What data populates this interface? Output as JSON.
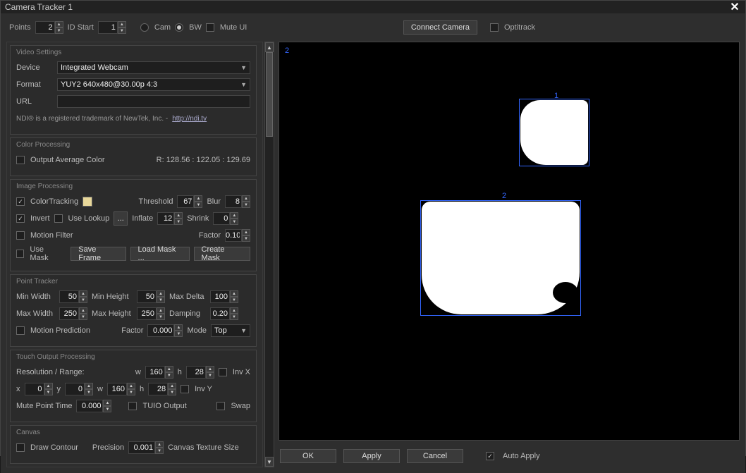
{
  "title": "Camera Tracker 1",
  "top": {
    "points_label": "Points",
    "points": "2",
    "idstart_label": "ID Start",
    "idstart": "1",
    "cam_label": "Cam",
    "bw_label": "BW",
    "muteui_label": "Mute UI",
    "connect_camera": "Connect Camera",
    "optitrack": "Optitrack"
  },
  "video": {
    "title": "Video Settings",
    "device_label": "Device",
    "device": "Integrated Webcam",
    "format_label": "Format",
    "format": "YUY2 640x480@30.00p 4:3",
    "url_label": "URL",
    "url": "",
    "ndi_text": "NDI® is a registered trademark of NewTek, Inc. -",
    "ndi_link": "http://ndi.tv"
  },
  "colorproc": {
    "title": "Color Processing",
    "output_avg_label": "Output Average Color",
    "rgb": "R: 128.56 : 122.05 : 129.69"
  },
  "imgproc": {
    "title": "Image Processing",
    "colortracking_label": "ColorTracking",
    "threshold_label": "Threshold",
    "threshold": "67",
    "blur_label": "Blur",
    "blur": "8",
    "invert_label": "Invert",
    "uselookup_label": "Use Lookup",
    "lookup_btn": "...",
    "inflate_label": "Inflate",
    "inflate": "12",
    "shrink_label": "Shrink",
    "shrink": "0",
    "motionfilter_label": "Motion Filter",
    "factor_label": "Factor",
    "factor": "0.10",
    "usemask_label": "Use Mask",
    "saveframe": "Save Frame",
    "loadmask": "Load Mask ...",
    "createmask": "Create Mask"
  },
  "pointtracker": {
    "title": "Point Tracker",
    "minwidth_label": "Min Width",
    "minwidth": "50",
    "minheight_label": "Min Height",
    "minheight": "50",
    "maxdelta_label": "Max Delta",
    "maxdelta": "100",
    "maxwidth_label": "Max Width",
    "maxwidth": "250",
    "maxheight_label": "Max Height",
    "maxheight": "250",
    "damping_label": "Damping",
    "damping": "0.20",
    "motionpred_label": "Motion Prediction",
    "factor_label": "Factor",
    "factor": "0.000",
    "mode_label": "Mode",
    "mode": "Top"
  },
  "touch": {
    "title": "Touch Output Processing",
    "resolution_label": "Resolution / Range:",
    "w_label": "w",
    "w": "160",
    "h_label": "h",
    "h": "28",
    "invx_label": "Inv X",
    "x_label": "x",
    "x": "0",
    "y_label": "y",
    "y": "0",
    "w2": "160",
    "h2": "28",
    "invy_label": "Inv Y",
    "mute_label": "Mute Point Time",
    "mute": "0.000",
    "tuio_label": "TUIO Output",
    "swap_label": "Swap"
  },
  "canvas": {
    "title": "Canvas",
    "drawcontour_label": "Draw Contour",
    "precision_label": "Precision",
    "precision": "0.001",
    "texsize_label": "Canvas Texture Size"
  },
  "preview": {
    "marker2": "2",
    "label1": "1",
    "label2": "2"
  },
  "footer": {
    "ok": "OK",
    "apply": "Apply",
    "cancel": "Cancel",
    "autoapply": "Auto Apply"
  }
}
